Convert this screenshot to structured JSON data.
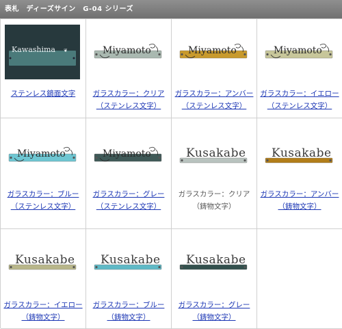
{
  "header": {
    "title": "表札　ディーズサイン　G-04 シリーズ"
  },
  "products": [
    {
      "name_line1": "ステンレス鏡面文字",
      "name_line2": "",
      "text": "Kawashima",
      "plate_color": "#4a7a7a",
      "link": true,
      "style": "mirror"
    },
    {
      "name_line1": "ガラスカラー：クリア",
      "name_line2": "（ステンレス文字）",
      "text": "Miyamoto",
      "plate_color": "#a9b8b0",
      "link": true,
      "style": "script"
    },
    {
      "name_line1": "ガラスカラー：アンバー",
      "name_line2": "（ステンレス文字）",
      "text": "Miyamoto",
      "plate_color": "#c89a2c",
      "link": true,
      "style": "script"
    },
    {
      "name_line1": "ガラスカラー：イエロー",
      "name_line2": "（ステンレス文字）",
      "text": "Miyamoto",
      "plate_color": "#c7c69a",
      "link": true,
      "style": "script"
    },
    {
      "name_line1": "ガラスカラー：ブルー",
      "name_line2": "（ステンレス文字）",
      "text": "Miyamoto",
      "plate_color": "#6ec6d2",
      "link": true,
      "style": "script"
    },
    {
      "name_line1": "ガラスカラー：グレー",
      "name_line2": "（ステンレス文字）",
      "text": "Miyamoto",
      "plate_color": "#3f5957",
      "link": true,
      "style": "script"
    },
    {
      "name_line1": "ガラスカラー：クリア",
      "name_line2": "（鋳物文字）",
      "text": "Kusakabe",
      "plate_color": "#b9c3bf",
      "link": false,
      "style": "cast"
    },
    {
      "name_line1": "ガラスカラー：アンバー",
      "name_line2": "（鋳物文字）",
      "text": "Kusakabe",
      "plate_color": "#b27e1a",
      "link": true,
      "style": "cast"
    },
    {
      "name_line1": "ガラスカラー：イエロー",
      "name_line2": "（鋳物文字）",
      "text": "Kusakabe",
      "plate_color": "#b8b68a",
      "link": true,
      "style": "cast"
    },
    {
      "name_line1": "ガラスカラー：ブルー",
      "name_line2": "（鋳物文字）",
      "text": "Kusakabe",
      "plate_color": "#5fb9c6",
      "link": true,
      "style": "cast"
    },
    {
      "name_line1": "ガラスカラー：グレー",
      "name_line2": "（鋳物文字）",
      "text": "Kusakabe",
      "plate_color": "#33504d",
      "link": true,
      "style": "cast"
    }
  ]
}
